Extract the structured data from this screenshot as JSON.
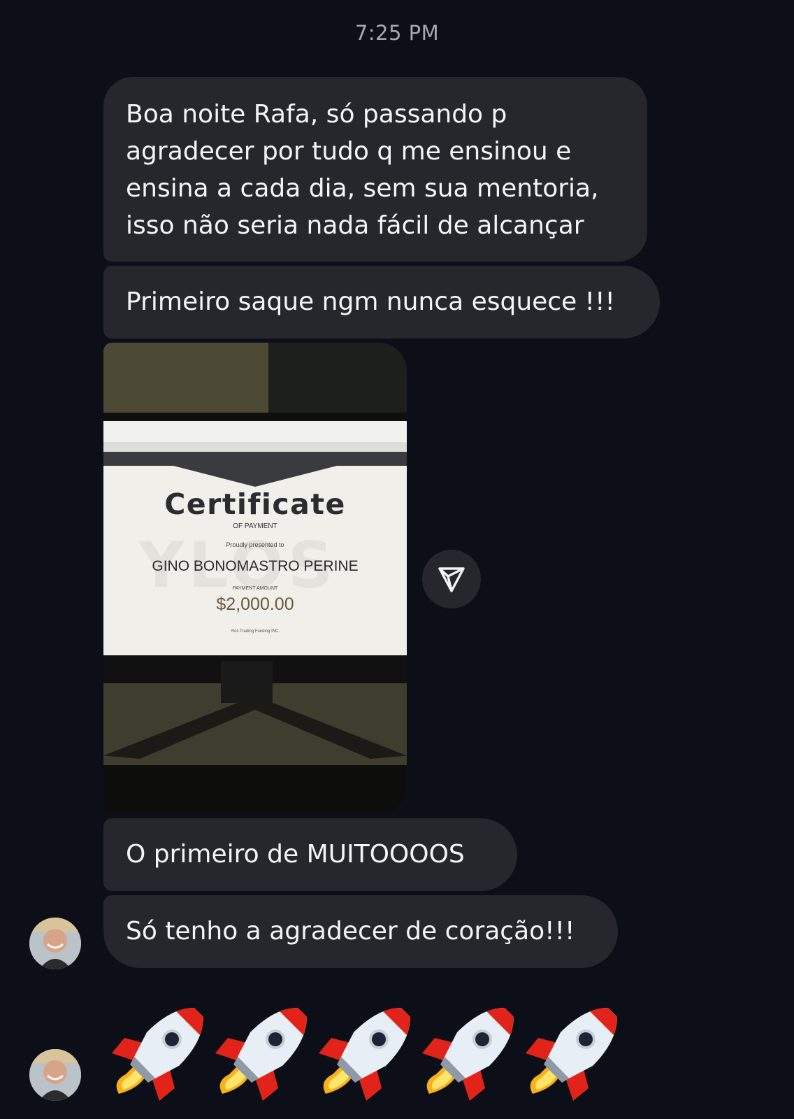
{
  "timestamp": "7:25 PM",
  "messages": {
    "m1_lines": [
      "Boa noite Rafa, só passando p",
      "agradecer por tudo q me ensinou e",
      "ensina a cada dia, sem sua mentoria,",
      "isso não seria nada fácil de alcançar"
    ],
    "m2": "Primeiro saque ngm nunca esquece !!!",
    "m3": "O primeiro de MUITOOOOS",
    "m4": "Só tenho a agradecer de coração!!!",
    "m5_emoji": "rocket x5"
  },
  "photo": {
    "certificate_title": "Certificate",
    "certificate_subtitle": "OF PAYMENT",
    "presented": "Proudly presented to",
    "name": "GINO BONOMASTRO PERINE",
    "amount_label": "PAYMENT AMOUNT",
    "amount": "$2,000.00",
    "footer": "Ylos Trading Funding INC.",
    "watermark": "YLOS"
  },
  "icons": {
    "share": "share-send-icon",
    "avatar": "avatar"
  },
  "colors": {
    "background": "#0c0f17",
    "bubble": "#25272d",
    "text": "#f3f4f6",
    "timestamp": "#a6a9b2"
  }
}
